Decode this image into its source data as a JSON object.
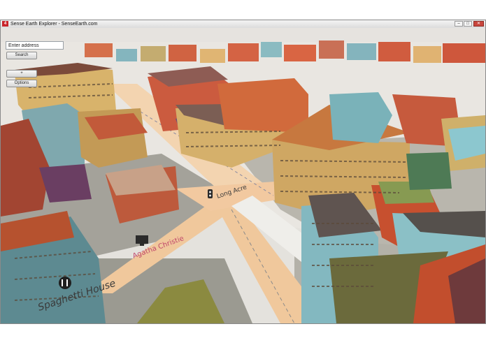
{
  "window": {
    "title": "Sense Earth Explorer - SenseEarth.com",
    "app_icon_text": "4",
    "controls": {
      "minimize": "–",
      "maximize": "□",
      "close": "✕"
    }
  },
  "panel": {
    "address_placeholder": "Enter address",
    "search_label": "Search",
    "zoom_label": "+",
    "options_label": "Options"
  },
  "map_labels": {
    "street": "Long Acre",
    "poi_1": "Agatha Christie",
    "poi_2": "Spaghetti House"
  },
  "icons": [
    "traffic-light-icon",
    "monitor-icon",
    "restaurant-icon"
  ],
  "colors": {
    "road": "#f2c9a0",
    "ground": "#e8e4de",
    "shadow": "#9d9c94",
    "title_icon": "#c8242a"
  }
}
